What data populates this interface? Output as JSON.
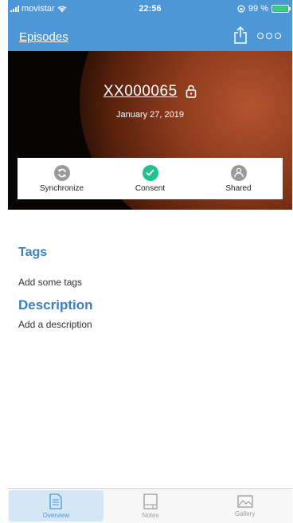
{
  "status_bar": {
    "carrier": "movistar",
    "time": "22:56",
    "battery_percent": "99 %",
    "battery_level": 0.99
  },
  "nav": {
    "back_label": "Episodes",
    "share_icon": "share-icon",
    "more_icon": "more-icon"
  },
  "episode": {
    "id": "XX000065",
    "date": "January 27, 2019"
  },
  "status_items": [
    {
      "label": "Synchronize",
      "icon": "sync-icon",
      "color": "#9a9a9a"
    },
    {
      "label": "Consent",
      "icon": "check-icon",
      "color": "#1fc28f"
    },
    {
      "label": "Shared",
      "icon": "person-icon",
      "color": "#9a9a9a"
    }
  ],
  "tags": {
    "title": "Tags",
    "placeholder": "Add some tags"
  },
  "description": {
    "title": "Description",
    "placeholder": "Add a description"
  },
  "tabs": [
    {
      "label": "Overview",
      "icon": "document-icon",
      "active": true
    },
    {
      "label": "Notes",
      "icon": "notes-icon",
      "active": false
    },
    {
      "label": "Gallery",
      "icon": "image-icon",
      "active": false
    }
  ],
  "colors": {
    "accent": "#4e97d6",
    "section_title": "#3a7fc1",
    "consent_green": "#1fc28f"
  }
}
